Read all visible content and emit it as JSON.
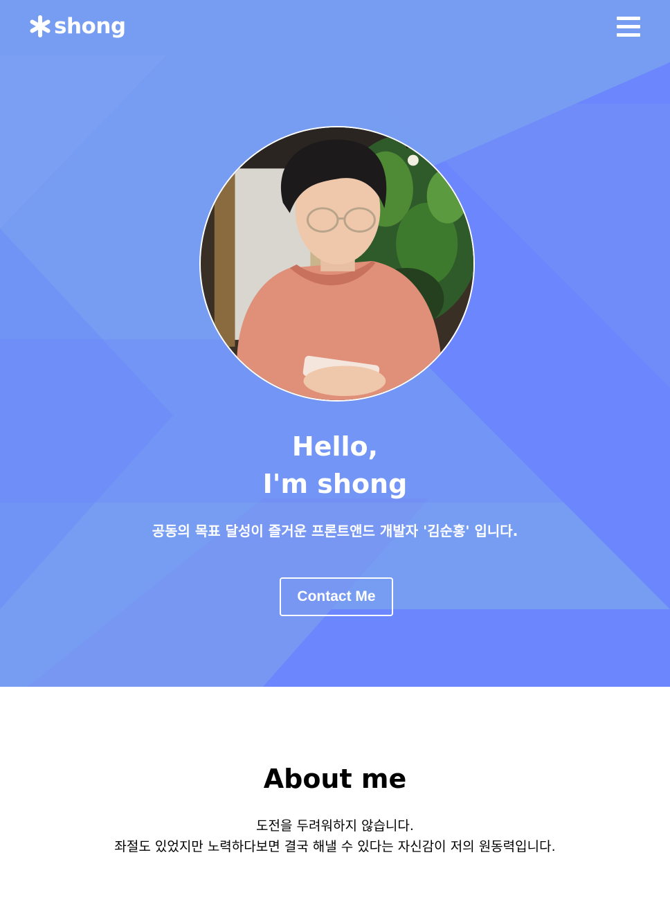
{
  "navbar": {
    "logo_icon": "asterisk-icon",
    "logo_text": "shong",
    "menu_icon": "hamburger-menu-icon"
  },
  "hero": {
    "title_line1": "Hello,",
    "title_line2": "I'm shong",
    "subtitle": "공동의 목표 달성이 즐거운 프론트앤드 개발자 '김순홍' 입니다.",
    "contact_label": "Contact Me"
  },
  "about": {
    "title": "About me",
    "line1": "도전을 두려워하지 않습니다.",
    "line2": "좌절도 있었지만 노력하다보면 결국 해낼 수 있다는 자신감이 저의 원동력입니다."
  },
  "colors": {
    "hero_bg": "#7a9cf2",
    "hero_accent": "#6e87fb",
    "text_light": "#ffffff",
    "text_dark": "#000000"
  }
}
